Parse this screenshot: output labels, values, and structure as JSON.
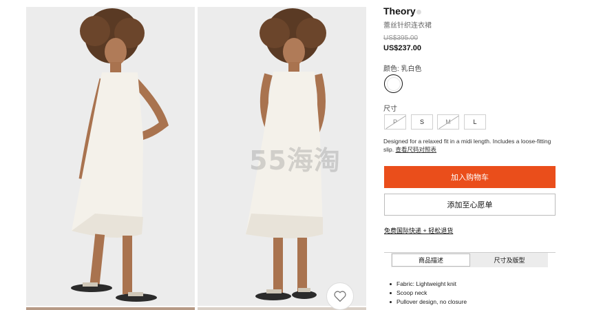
{
  "product": {
    "brand": "Theory",
    "subtitle": "蕾丝针织连衣裙",
    "price_original": "US$395.00",
    "price_sale": "US$237.00",
    "color_label": "颜色: 乳白色",
    "color_swatch": "#ffffff",
    "size_label": "尺寸",
    "sizes": [
      {
        "label": "P",
        "available": false
      },
      {
        "label": "S",
        "available": true
      },
      {
        "label": "M",
        "available": false
      },
      {
        "label": "L",
        "available": true
      }
    ],
    "description": "Designed for a relaxed fit in a midi length. Includes a loose-fitting slip.",
    "size_guide_link": "查看尺码对照表"
  },
  "actions": {
    "add_to_cart": "加入购物车",
    "add_to_wishlist": "添加至心愿单",
    "shipping_link": "免费国际快递 + 轻松退货"
  },
  "tabs": {
    "details": "商品描述",
    "size_fit": "尺寸及版型"
  },
  "features": [
    "Fabric: Lightweight knit",
    "Scoop neck",
    "Pullover design, no closure"
  ],
  "watermark": "55海淘",
  "colors": {
    "accent": "#ea4e1b",
    "dress": "#f4f1ea",
    "background": "#ececec"
  }
}
